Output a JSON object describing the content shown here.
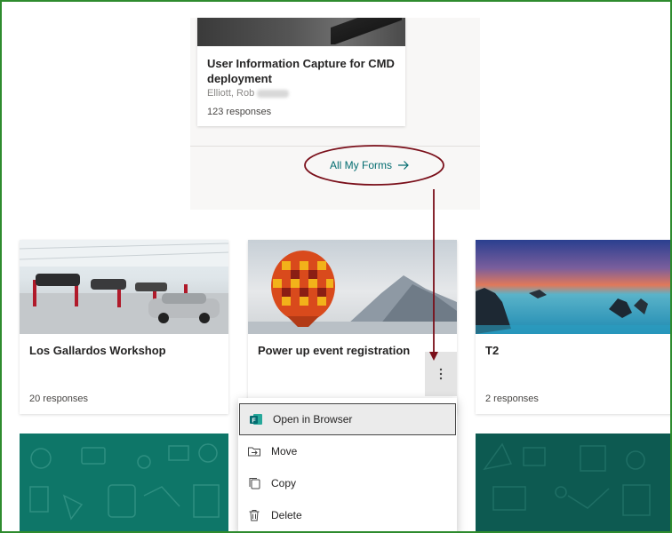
{
  "top_card": {
    "title": "User Information Capture for CMD deployment",
    "owner": "Elliott, Rob",
    "responses": "123 responses"
  },
  "all_forms_link": {
    "label": "All My Forms"
  },
  "cards": [
    {
      "title": "Los Gallardos Workshop",
      "responses": "20 responses"
    },
    {
      "title": "Power up event registration",
      "responses": ""
    },
    {
      "title": "T2",
      "responses": "2 responses"
    }
  ],
  "context_menu": {
    "items": [
      {
        "label": "Open in Browser",
        "icon": "forms-app-icon"
      },
      {
        "label": "Move",
        "icon": "move-folder-icon"
      },
      {
        "label": "Copy",
        "icon": "copy-icon"
      },
      {
        "label": "Delete",
        "icon": "trash-icon"
      }
    ]
  },
  "colors": {
    "link": "#036c70",
    "annotation": "#7a0f1a",
    "teal": "#0e7668",
    "frame": "#2e8b2e"
  }
}
